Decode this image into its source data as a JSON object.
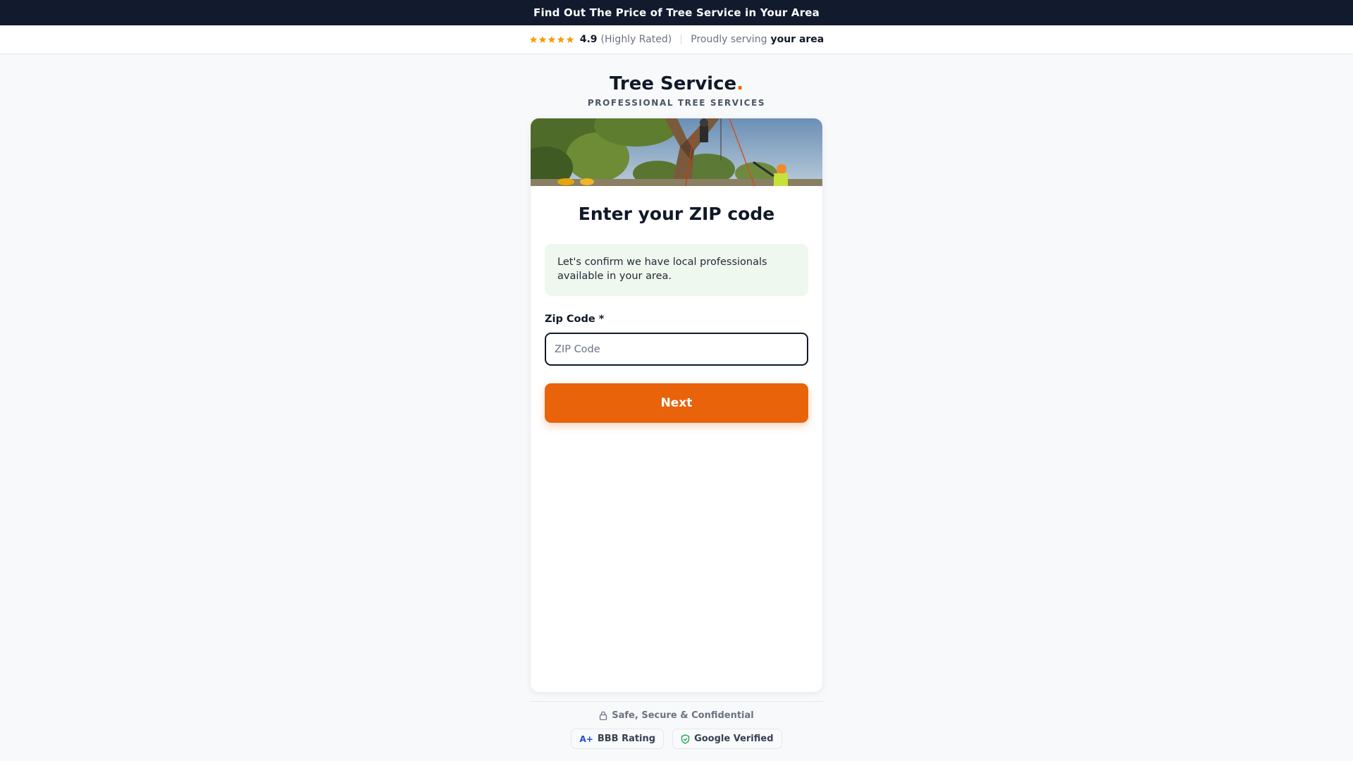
{
  "banner": {
    "text": "Find Out The Price of Tree Service in Your Area"
  },
  "rating": {
    "stars": 5,
    "value": "4.9",
    "label": "(Highly Rated)",
    "serving_prefix": "Proudly serving",
    "serving_area": "your area"
  },
  "brand": {
    "name": "Tree Service",
    "dot": ".",
    "tagline": "PROFESSIONAL TREE SERVICES"
  },
  "form": {
    "heading": "Enter your ZIP code",
    "info": "Let's confirm we have local professionals available in your area.",
    "zip_label": "Zip Code *",
    "zip_placeholder": "ZIP Code",
    "zip_value": "",
    "next_label": "Next"
  },
  "footer": {
    "secure_text": "Safe, Secure & Confidential",
    "bbb_mark": "A+",
    "bbb_label": "BBB Rating",
    "google_label": "Google Verified"
  },
  "colors": {
    "accent": "#e8630a",
    "banner": "#121a2e",
    "info_bg": "#eff8ee",
    "star": "#f59e0b"
  },
  "icons": [
    "star-icon",
    "lock-icon",
    "shield-check-icon"
  ]
}
